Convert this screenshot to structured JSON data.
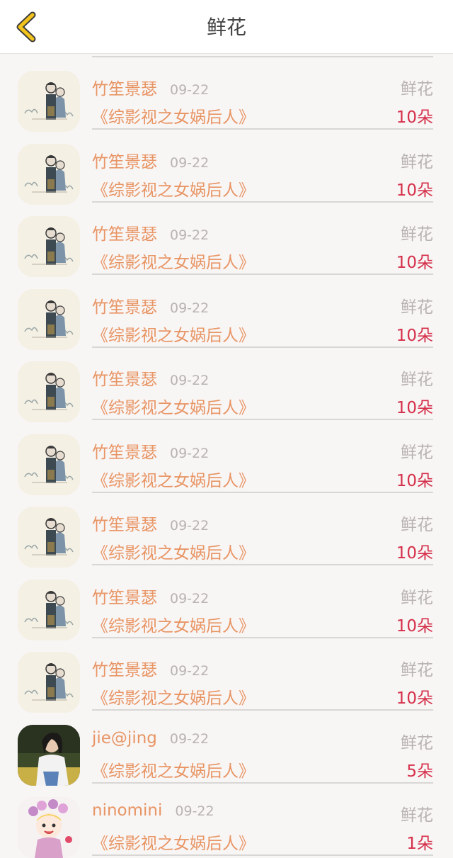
{
  "header": {
    "title": "鲜花",
    "back_icon": "chevron-left-icon",
    "accent": "#f2c31c"
  },
  "rows": [
    {
      "name": "竹笙景瑟",
      "date": "09-22",
      "type": "鲜花",
      "book": "《综影视之女娲后人》",
      "count": "10朵",
      "avatar": "illustration-avatar"
    },
    {
      "name": "竹笙景瑟",
      "date": "09-22",
      "type": "鲜花",
      "book": "《综影视之女娲后人》",
      "count": "10朵",
      "avatar": "illustration-avatar"
    },
    {
      "name": "竹笙景瑟",
      "date": "09-22",
      "type": "鲜花",
      "book": "《综影视之女娲后人》",
      "count": "10朵",
      "avatar": "illustration-avatar"
    },
    {
      "name": "竹笙景瑟",
      "date": "09-22",
      "type": "鲜花",
      "book": "《综影视之女娲后人》",
      "count": "10朵",
      "avatar": "illustration-avatar"
    },
    {
      "name": "竹笙景瑟",
      "date": "09-22",
      "type": "鲜花",
      "book": "《综影视之女娲后人》",
      "count": "10朵",
      "avatar": "illustration-avatar"
    },
    {
      "name": "竹笙景瑟",
      "date": "09-22",
      "type": "鲜花",
      "book": "《综影视之女娲后人》",
      "count": "10朵",
      "avatar": "illustration-avatar"
    },
    {
      "name": "竹笙景瑟",
      "date": "09-22",
      "type": "鲜花",
      "book": "《综影视之女娲后人》",
      "count": "10朵",
      "avatar": "illustration-avatar"
    },
    {
      "name": "竹笙景瑟",
      "date": "09-22",
      "type": "鲜花",
      "book": "《综影视之女娲后人》",
      "count": "10朵",
      "avatar": "illustration-avatar"
    },
    {
      "name": "竹笙景瑟",
      "date": "09-22",
      "type": "鲜花",
      "book": "《综影视之女娲后人》",
      "count": "10朵",
      "avatar": "illustration-avatar"
    },
    {
      "name": "jie@jing",
      "date": "09-22",
      "type": "鲜花",
      "book": "《综影视之女娲后人》",
      "count": "5朵",
      "avatar": "photo-avatar"
    },
    {
      "name": "ninomini",
      "date": "09-22",
      "type": "鲜花",
      "book": "《综影视之女娲后人》",
      "count": "1朵",
      "avatar": "cartoon-avatar"
    }
  ],
  "colors": {
    "name": "#e89564",
    "meta": "#b9b3b3",
    "count": "#d5304a",
    "background": "#f8f5f5"
  }
}
